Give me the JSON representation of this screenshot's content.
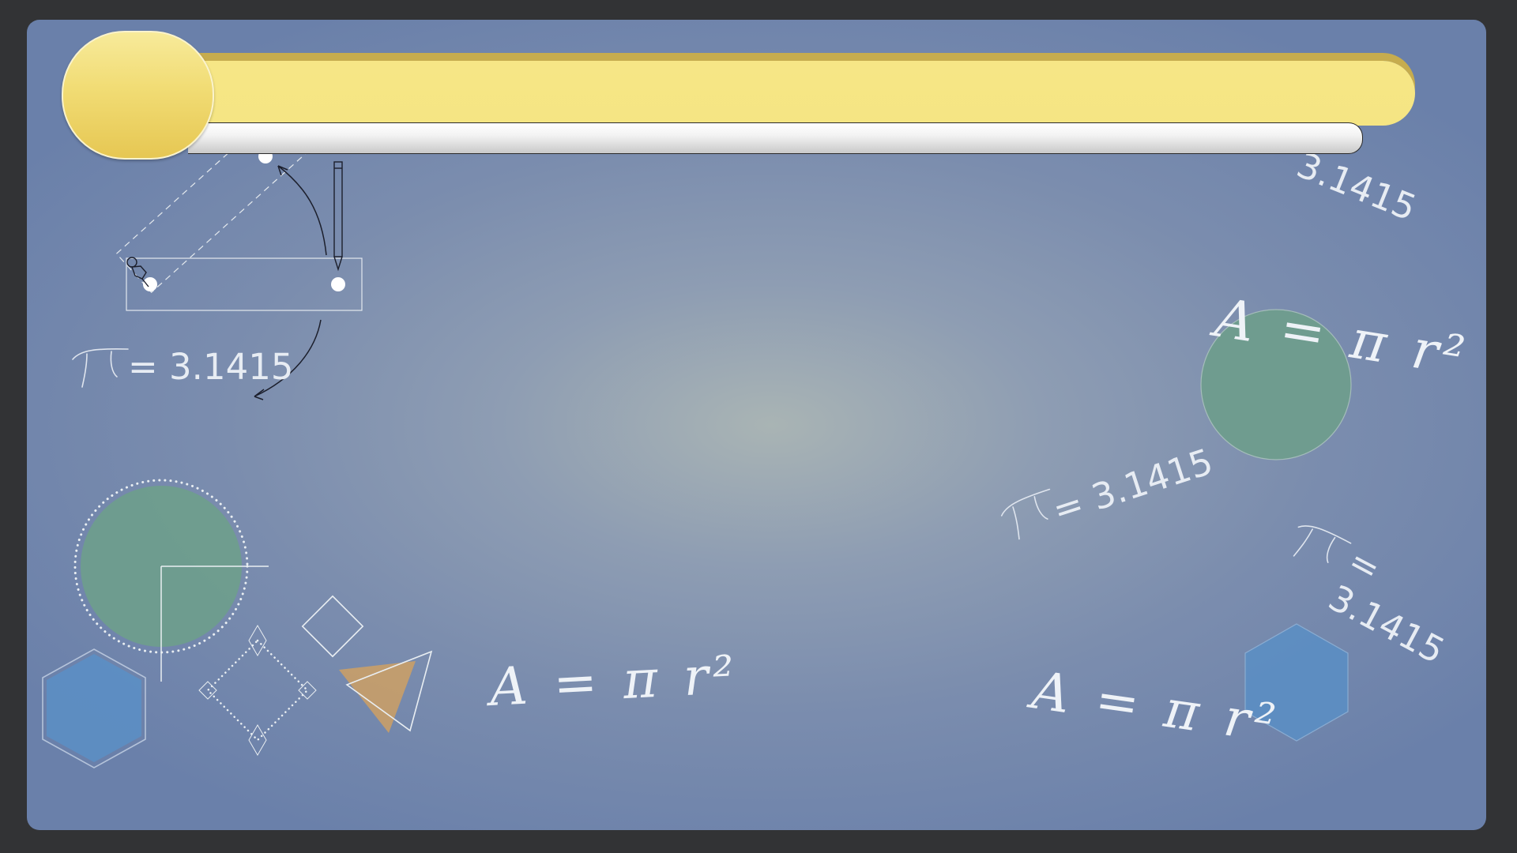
{
  "formulas": {
    "pi_a": "= 3.1415",
    "pi_b": "= 3.1415",
    "pi_c": "= 3.1415",
    "pi_top": "3.1415",
    "area_r": "A = π r²",
    "area_c": "A = π r²",
    "area_b": "A = π r²"
  },
  "colors": {
    "background_center": "#a9b4b4",
    "background_edge": "#6a80aa",
    "banner_yellow": "#f5e583",
    "banner_knob": "#f1dc74",
    "banner_grey": "#e6e6e6",
    "circle_green": "#6e9e8c",
    "hexagon_blue": "#5a8fc5",
    "triangle_orange": "#c99f68"
  },
  "icons": {
    "pencil": "pencil-icon",
    "pin": "pin-icon"
  }
}
